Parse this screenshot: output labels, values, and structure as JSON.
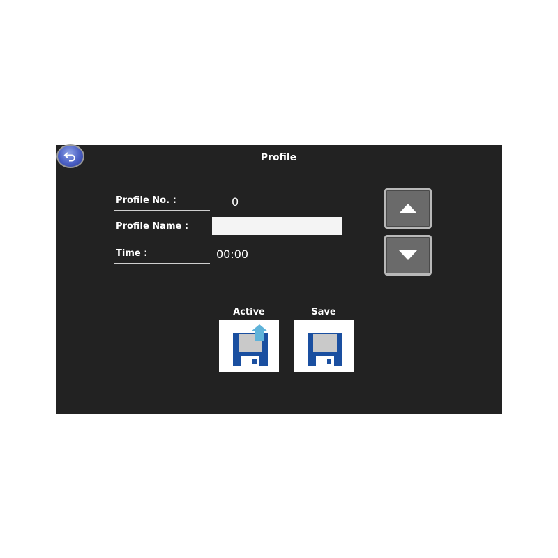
{
  "window": {
    "title": "Profile"
  },
  "fields": {
    "profile_no_label": "Profile No. :",
    "profile_no_value": "0",
    "profile_name_label": "Profile Name :",
    "profile_name_value": "",
    "time_label": "Time :",
    "time_value": "00:00"
  },
  "actions": {
    "active_label": "Active",
    "save_label": "Save"
  },
  "icons": {
    "back": "back-arrow-icon",
    "up": "arrow-up-icon",
    "down": "arrow-down-icon",
    "active": "floppy-upload-icon",
    "save": "floppy-disk-icon"
  },
  "colors": {
    "panel_bg": "#222222",
    "disk_blue": "#1a4fa0",
    "upload_arrow": "#5fb3d9"
  }
}
